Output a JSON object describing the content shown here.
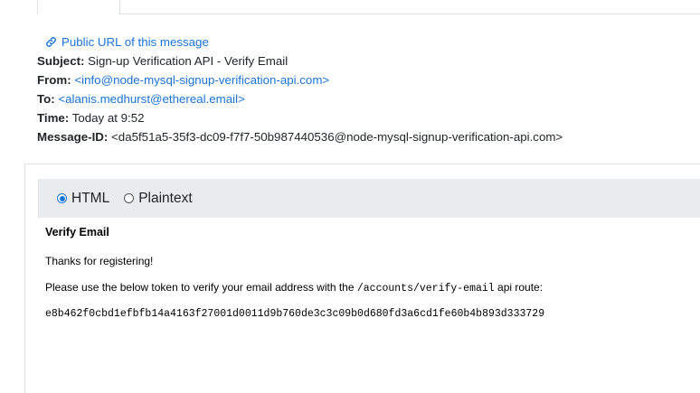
{
  "header": {
    "public_url_label": "Public URL of this message"
  },
  "meta": {
    "subject_label": "Subject:",
    "subject_value": "Sign-up Verification API - Verify Email",
    "from_label": "From:",
    "from_value": "<info@node-mysql-signup-verification-api.com>",
    "to_label": "To:",
    "to_value": "<alanis.medhurst@ethereal.email>",
    "time_label": "Time:",
    "time_value": "Today at 9:52",
    "message_id_label": "Message-ID:",
    "message_id_value": "<da5f51a5-35f3-dc09-f7f7-50b987440536@node-mysql-signup-verification-api.com>"
  },
  "format": {
    "options": [
      {
        "label": "HTML",
        "selected": true
      },
      {
        "label": "Plaintext",
        "selected": false
      }
    ]
  },
  "body": {
    "heading": "Verify Email",
    "thanks": "Thanks for registering!",
    "instruction_before": "Please use the below token to verify your email address with the ",
    "route_code": "/accounts/verify-email",
    "instruction_after": " api route:",
    "token": "e8b462f0cbd1efbfb14a4163f27001d0011d9b760de3c3c09b0d680fd3a6cd1fe60b4b893d333729"
  },
  "colors": {
    "link": "#1a73d6",
    "format_bar_bg": "#e9ecef",
    "border": "#dee2e6"
  },
  "icons": {
    "public_url": "link-icon"
  }
}
